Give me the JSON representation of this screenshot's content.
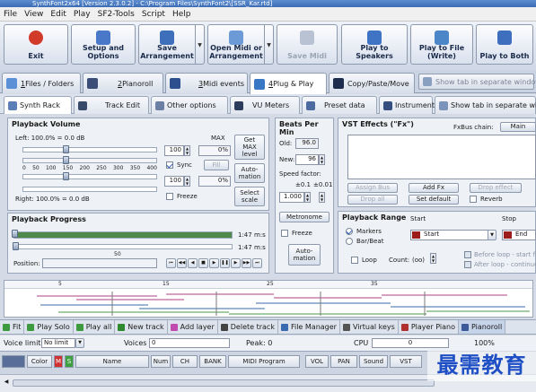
{
  "window": {
    "title": "SynthFont2x64 [Version 2.3.0.2] - C:\\Program Files\\SynthFont2\\[SSR_Kar.rtd]"
  },
  "menu": [
    "File",
    "View",
    "Edit",
    "Play",
    "SF2-Tools",
    "Script",
    "Help"
  ],
  "toolbar": {
    "exit": "Exit",
    "setup": [
      "Setup and",
      "Options"
    ],
    "save_arr": [
      "Save",
      "Arrangement"
    ],
    "open_midi": [
      "Open Midi or",
      "Arrangement"
    ],
    "save_midi": "Save Midi",
    "play_speakers": [
      "Play to",
      "Speakers"
    ],
    "play_file": [
      "Play to File",
      "(Write)"
    ],
    "play_both": "Play to Both"
  },
  "tabs1": [
    {
      "num": "1",
      "label": " Files / Folders"
    },
    {
      "num": "2",
      "label": " Pianoroll"
    },
    {
      "num": "3",
      "label": " Midi events"
    },
    {
      "num": "4",
      "label": " Plug & Play"
    },
    {
      "num": "",
      "label": "Copy/Paste/Move"
    }
  ],
  "show_separate_1": "Show tab in separate window",
  "tabs2": [
    "Synth Rack",
    "Track Edit",
    "Other options",
    "VU Meters",
    "Preset data",
    "Instruments"
  ],
  "show_separate_2": "Show tab in separate window",
  "volume": {
    "title": "Playback Volume",
    "left": "Left: 100.0% = 0.0 dB",
    "right": "Right: 100.0% = 0.0 dB",
    "max": "MAX",
    "val1": "100",
    "val2": "100",
    "pct1": "0%",
    "pct2": "0%",
    "sync": "Sync",
    "fill": "Fill",
    "freeze": "Freeze",
    "get_max": [
      "Get",
      "MAX",
      "level"
    ],
    "automation": [
      "Auto-",
      "mation"
    ],
    "select_scale": [
      "Select",
      "scale"
    ],
    "ticks": [
      "0",
      "50",
      "100",
      "150",
      "200",
      "250",
      "300",
      "350",
      "400"
    ]
  },
  "bpm": {
    "title": "Beats Per Min",
    "old_label": "Old:",
    "old": "96.0",
    "new_label": "New:",
    "new": "96",
    "speed": "Speed factor:",
    "pm1": "±0.1",
    "pm2": "±0.01",
    "speed_val": "1.000",
    "metronome": "Metronome",
    "freeze": "Freeze",
    "automation": [
      "Auto-",
      "mation"
    ]
  },
  "vst": {
    "title": "VST Effects (\"Fx\")",
    "chain_label": "FxBus chain:",
    "chain": "Main",
    "assign": "Assign Bus",
    "drop_all": "Drop all",
    "add_fx": "Add Fx",
    "set_default": "Set default",
    "drop_effect": "Drop effect",
    "reverb": "Reverb"
  },
  "progress": {
    "title": "Playback Progress",
    "time1": "1:47 m:s",
    "time2": "1:47 m:s",
    "mark": "50",
    "position": "Position:",
    "fill_fraction": 1.0
  },
  "range": {
    "title": "Playback Range",
    "start": "Start",
    "stop": "Stop",
    "markers": "Markers",
    "barbeat": "Bar/Beat",
    "start_val": "Start",
    "end_val": "End",
    "loop": "Loop",
    "count": "Count:",
    "count_val": "(oo)",
    "before": "Before loop - start from",
    "after": "After loop - continue"
  },
  "track_marks": [
    "5",
    "15",
    "25",
    "35"
  ],
  "bottom": [
    "Fit",
    "Play Solo",
    "Play all",
    "New track",
    "Add layer",
    "Delete track",
    "File Manager",
    "Virtual keys",
    "Player Piano",
    "Pianoroll"
  ],
  "status": {
    "voice_limit_label": "Voice limit:",
    "voice_limit": "No limit",
    "voices": "Voices",
    "voices_val": "0",
    "peak": "Peak: 0",
    "cpu": "CPU",
    "cpu_val": "0",
    "cpu_pct": "100%"
  },
  "headers": [
    "Color",
    "M",
    "S",
    "Name",
    "Num",
    "CH",
    "BANK",
    "MIDI Program",
    "VOL",
    "PAN",
    "Sound",
    "VST"
  ],
  "watermark": "最需教育",
  "colors": {
    "accent": "#3b6cb4",
    "progress": "#4f8a4a",
    "exit": "#d23a2a"
  }
}
